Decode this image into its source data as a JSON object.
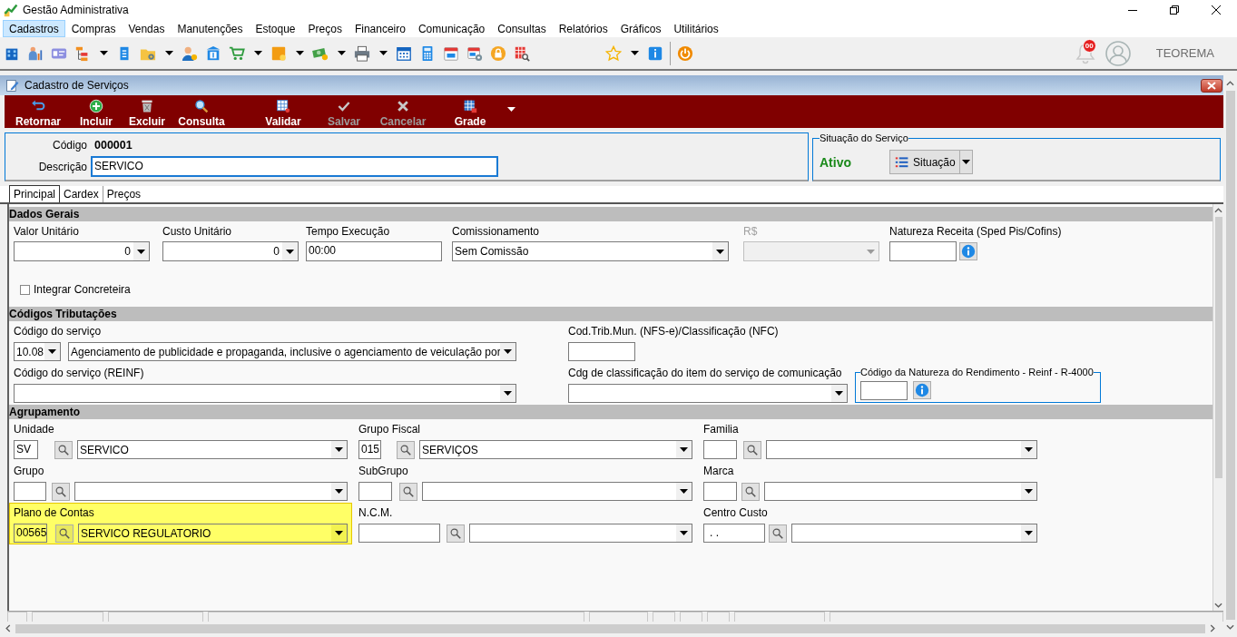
{
  "window": {
    "title": "Gestão Administrativa"
  },
  "menu": [
    {
      "label": "Cadastros",
      "selected": true
    },
    {
      "label": "Compras",
      "selected": false
    },
    {
      "label": "Vendas",
      "selected": false
    },
    {
      "label": "Manutenções",
      "selected": false
    },
    {
      "label": "Estoque",
      "selected": false
    },
    {
      "label": "Preços",
      "selected": false
    },
    {
      "label": "Financeiro",
      "selected": false
    },
    {
      "label": "Comunicação",
      "selected": false
    },
    {
      "label": "Consultas",
      "selected": false
    },
    {
      "label": "Relatórios",
      "selected": false
    },
    {
      "label": "Gráficos",
      "selected": false
    },
    {
      "label": "Utilitários",
      "selected": false
    }
  ],
  "toolbar": {
    "notifications": "00",
    "user": "TEOREMA"
  },
  "child_window": {
    "title": "Cadastro de Serviços"
  },
  "actions": [
    {
      "label": "Retornar",
      "disabled": false
    },
    {
      "label": "Incluir",
      "disabled": false
    },
    {
      "label": "Excluir",
      "disabled": false
    },
    {
      "label": "Consulta",
      "disabled": false
    },
    {
      "label": "Validar",
      "disabled": false
    },
    {
      "label": "Salvar",
      "disabled": true
    },
    {
      "label": "Cancelar",
      "disabled": true
    },
    {
      "label": "Grade",
      "disabled": false
    }
  ],
  "record": {
    "code_label": "Código",
    "code": "000001",
    "description_label": "Descrição",
    "description": "SERVICO"
  },
  "status_group": {
    "title": "Situação do Serviço",
    "status": "Ativo",
    "button": "Situação"
  },
  "tabs": [
    {
      "label": "Principal",
      "selected": true
    },
    {
      "label": "Cardex",
      "selected": false
    },
    {
      "label": "Preços",
      "selected": false
    }
  ],
  "dados_gerais": {
    "title": "Dados Gerais",
    "fields": [
      {
        "kind": "spin",
        "label": "Valor Unitário",
        "value": "0",
        "disabled": false
      },
      {
        "kind": "spin",
        "label": "Custo Unitário",
        "value": "0",
        "disabled": false
      },
      {
        "kind": "text",
        "label": "Tempo Execução",
        "value": "00:00",
        "disabled": false
      },
      {
        "kind": "select",
        "label": "Comissionamento",
        "value": "Sem Comissão",
        "disabled": false
      },
      {
        "kind": "select",
        "label": "R$",
        "disabled": true
      },
      {
        "kind": "info",
        "label": "Natureza Receita (Sped Pis/Cofins)",
        "disabled": false
      }
    ],
    "checkbox": {
      "label": "Integrar Concreteira",
      "checked": false
    }
  },
  "codigos_tributacoes": {
    "title": "Códigos Tributações",
    "fields": [
      {
        "kind": "code-select",
        "label": "Código do serviço",
        "code": "10.08",
        "value": "Agenciamento de publicidade e propaganda, inclusive o agenciamento de veiculação por"
      },
      {
        "kind": "text",
        "label": "Cod.Trib.Mun. (NFS-e)/Classificação (NFC)"
      },
      {
        "kind": "select",
        "label": "Código do serviço (REINF)"
      },
      {
        "kind": "select",
        "label": "Cdg de classificação do item do serviço de comunicação"
      },
      {
        "kind": "group-info",
        "label": "Código da Natureza do Rendimento - Reinf - R-4000"
      }
    ]
  },
  "agrupamento": {
    "title": "Agrupamento",
    "fields": [
      {
        "label": "Unidade",
        "code": "SV",
        "value": "SERVICO",
        "highlighted": false
      },
      {
        "label": "Grupo Fiscal",
        "code": "015",
        "value": "SERVIÇOS",
        "highlighted": false
      },
      {
        "label": "Familia",
        "highlighted": false
      },
      {
        "label": "Grupo",
        "highlighted": false
      },
      {
        "label": "SubGrupo",
        "highlighted": false
      },
      {
        "label": "Marca",
        "highlighted": false
      },
      {
        "label": "Plano de Contas",
        "code": "00565",
        "value": "SERVICO REGULATORIO",
        "highlighted": true
      },
      {
        "label": "N.C.M.",
        "highlighted": false
      },
      {
        "label": "Centro Custo",
        "code": ". .",
        "highlighted": false
      }
    ]
  }
}
